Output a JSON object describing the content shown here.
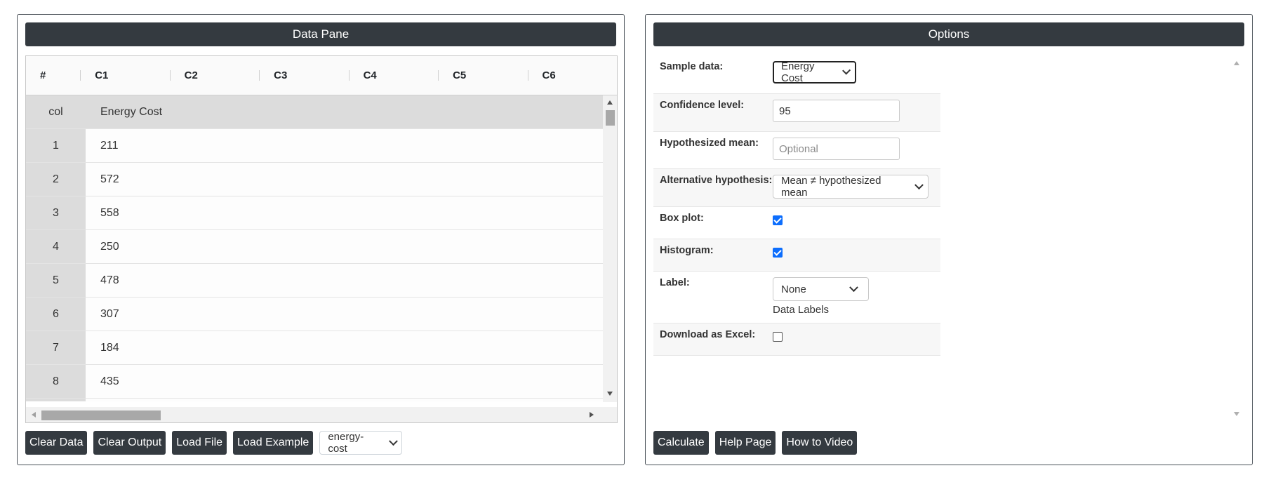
{
  "data_pane": {
    "title": "Data Pane",
    "columns": [
      "#",
      "C1",
      "C2",
      "C3",
      "C4",
      "C5",
      "C6"
    ],
    "header_row": {
      "label": "col",
      "value": "Energy Cost"
    },
    "rows": [
      {
        "n": "1",
        "v": "211"
      },
      {
        "n": "2",
        "v": "572"
      },
      {
        "n": "3",
        "v": "558"
      },
      {
        "n": "4",
        "v": "250"
      },
      {
        "n": "5",
        "v": "478"
      },
      {
        "n": "6",
        "v": "307"
      },
      {
        "n": "7",
        "v": "184"
      },
      {
        "n": "8",
        "v": "435"
      },
      {
        "n": "",
        "v": ""
      }
    ],
    "buttons": {
      "clear_data": "Clear Data",
      "clear_output": "Clear Output",
      "load_file": "Load File",
      "load_example": "Load Example"
    },
    "example_select": "energy-cost"
  },
  "options": {
    "title": "Options",
    "sample_data": {
      "label": "Sample data:",
      "value": "Energy Cost"
    },
    "confidence": {
      "label": "Confidence level:",
      "value": "95"
    },
    "hyp_mean": {
      "label": "Hypothesized mean:",
      "placeholder": "Optional"
    },
    "alternative": {
      "label": "Alternative hypothesis:",
      "value": "Mean ≠ hypothesized mean"
    },
    "box_plot": {
      "label": "Box plot:",
      "checked": true
    },
    "histogram": {
      "label": "Histogram:",
      "checked": true
    },
    "label": {
      "label": "Label:",
      "value": "None",
      "sub": "Data Labels"
    },
    "download": {
      "label": "Download as Excel:",
      "checked": false
    },
    "buttons": {
      "calculate": "Calculate",
      "help": "Help Page",
      "video": "How to Video"
    }
  },
  "colors": {
    "header_bg": "#343a40",
    "accent": "#0d6efd",
    "row_header_bg": "#dcdcdc"
  }
}
